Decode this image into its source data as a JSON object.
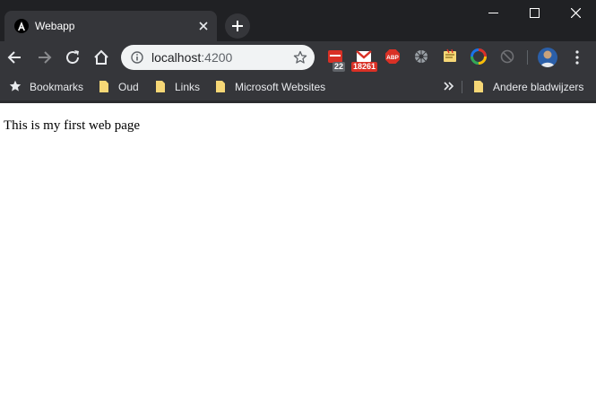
{
  "browser": {
    "tab": {
      "title": "Webapp",
      "favicon": "angular-icon"
    },
    "window_controls": [
      "minimize-icon",
      "maximize-icon",
      "close-icon"
    ]
  },
  "toolbar": {
    "url_host": "localhost",
    "url_port": ":4200",
    "extensions": [
      {
        "icon": "calendar-extension-icon",
        "badge": "22"
      },
      {
        "icon": "gmail-extension-icon",
        "badge": "18261"
      },
      {
        "icon": "adblock-plus-icon",
        "text": "ABP"
      },
      {
        "icon": "gear-extension-icon"
      },
      {
        "icon": "notes-extension-icon"
      },
      {
        "icon": "color-picker-extension-icon"
      },
      {
        "icon": "disabled-extension-icon"
      }
    ]
  },
  "bookmarks": {
    "items": [
      {
        "label": "Bookmarks",
        "icon": "star-icon"
      },
      {
        "label": "Oud",
        "icon": "folder-icon"
      },
      {
        "label": "Links",
        "icon": "folder-icon"
      },
      {
        "label": "Microsoft Websites",
        "icon": "folder-icon"
      }
    ],
    "other": {
      "label": "Andere bladwijzers",
      "icon": "folder-icon"
    }
  },
  "page": {
    "text": "This is my first web page"
  },
  "colors": {
    "frame": "#202124",
    "toolbar": "#35363a",
    "omnibox": "#f1f3f4",
    "folder": "#f6d776"
  }
}
